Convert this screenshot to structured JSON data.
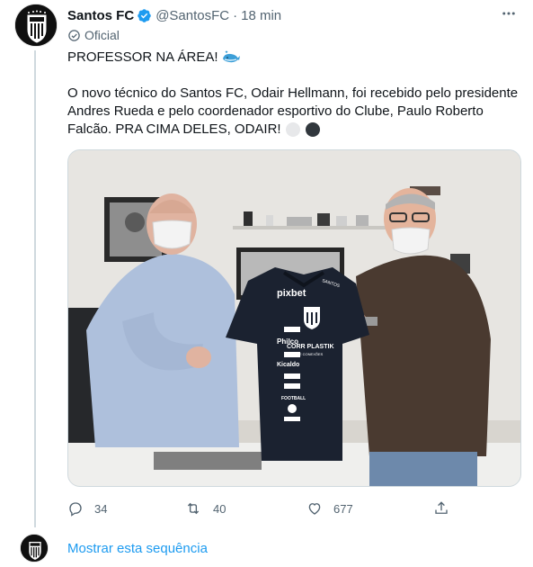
{
  "tweet": {
    "author_name": "Santos FC",
    "handle": "@SantosFC",
    "separator": "·",
    "time": "18 min",
    "official_label": "Oficial",
    "line1": "PROFESSOR NA ÁREA!",
    "paragraph2": "O novo técnico do Santos FC, Odair Hellmann, foi recebido pelo presidente Andres Rueda e pelo coordenador esportivo do Clube, Paulo Roberto Falcão. PRA CIMA DELES, ODAIR!",
    "media": {
      "shirt_texts": [
        "pixbet",
        "Philco",
        "Kicaldo",
        "FOOTBALL",
        "CORR PLASTIK",
        "TUBOS E CONEXÕES",
        "SANTOS"
      ]
    },
    "stats": {
      "replies": "34",
      "retweets": "40",
      "likes": "677"
    }
  },
  "thread": {
    "show_label": "Mostrar esta sequência"
  },
  "colors": {
    "accent": "#1d9bf0",
    "muted": "#536471",
    "shirt": "#1b2230"
  },
  "icons": [
    "verified-badge-icon",
    "more-icon",
    "official-label-icon",
    "whale-emoji",
    "white-circle-emoji",
    "black-circle-emoji",
    "reply-icon",
    "retweet-icon",
    "like-icon",
    "share-icon"
  ]
}
